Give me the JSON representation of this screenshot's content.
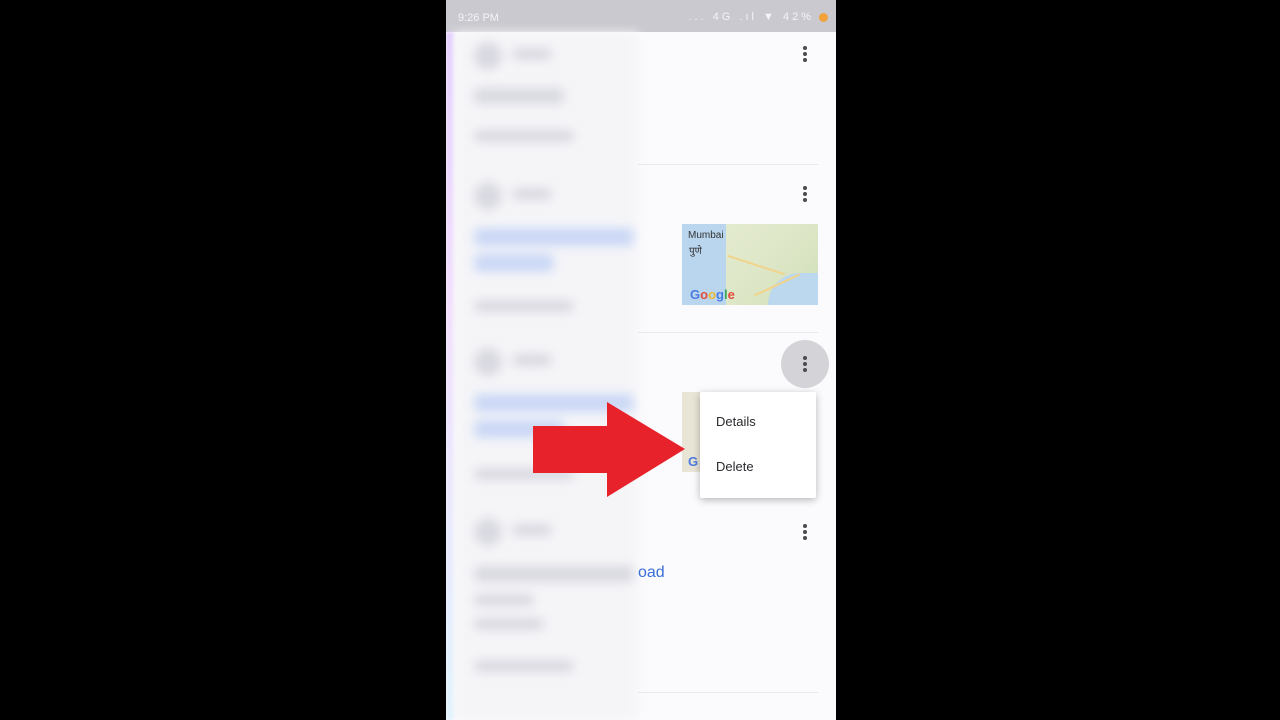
{
  "status_bar": {
    "time": "9:26 PM",
    "right_indicators": "... 4G .ıl ▼ 42%"
  },
  "cards": [
    {
      "menu_icon": "more-vert-icon"
    },
    {
      "menu_icon": "more-vert-icon",
      "map": {
        "label": "Mumbai",
        "sub_label": "पुणे",
        "brand": "Google"
      }
    },
    {
      "menu_icon": "more-vert-icon",
      "map_brand_fragment": "G",
      "popup_menu": {
        "items": [
          "Details",
          "Delete"
        ]
      }
    },
    {
      "menu_icon": "more-vert-icon",
      "link_fragment": "oad"
    }
  ],
  "overlay": {
    "arrow_color": "#e8222a"
  },
  "colors": {
    "accent_link": "#3a6fd8",
    "status_bar": "#c9c9cf"
  }
}
